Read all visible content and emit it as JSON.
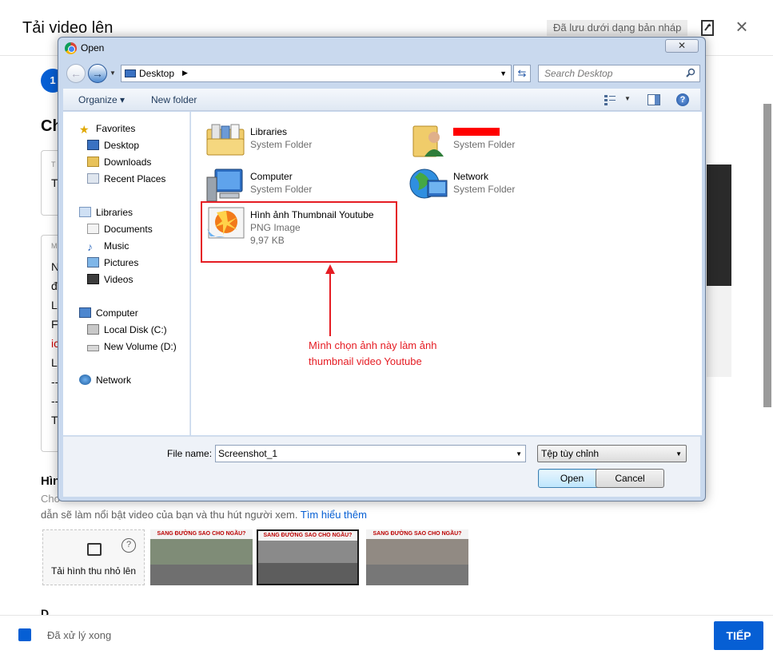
{
  "youtube": {
    "title": "Tải video lên",
    "draft_badge": "Đã lưu dưới dạng bản nháp",
    "step_number": "1",
    "heading_fragment": "Ch",
    "box1": {
      "label_fragment": "T",
      "value_fragment": "T"
    },
    "box2": {
      "label_fragment": "M",
      "lines": [
        "N",
        "đ",
        "L",
        "F",
        "ic",
        "L",
        "--",
        "--",
        "T"
      ]
    },
    "thumbnail_title_fragment": "Hìn",
    "thumbnail_desc_fragment": "Cho",
    "thumbnail_desc": "dẫn sẽ làm nổi bật video của bạn và thu hút người xem.",
    "learn_more": "Tìm hiểu thêm",
    "upload_tile_label": "Tải hình thu nhỏ lên",
    "upload_tile_help": "?",
    "thumb_caption": "SANG ĐƯỜNG SAO CHO NGẦU?",
    "footer_fragment": "D",
    "status_text": "Đã xử lý xong",
    "next_button": "TIẾP"
  },
  "dialog": {
    "title": "Open",
    "close_label": "✕",
    "address": "Desktop",
    "search_placeholder": "Search Desktop",
    "toolbar": {
      "organize": "Organize ▾",
      "new_folder": "New folder"
    },
    "nav": {
      "favorites": "Favorites",
      "desktop": "Desktop",
      "downloads": "Downloads",
      "recent": "Recent Places",
      "libraries": "Libraries",
      "documents": "Documents",
      "music": "Music",
      "pictures": "Pictures",
      "videos": "Videos",
      "computer": "Computer",
      "local_disk": "Local Disk (C:)",
      "new_volume": "New Volume (D:)",
      "network": "Network"
    },
    "files": [
      {
        "name": "Libraries",
        "type": "System Folder"
      },
      {
        "name": "",
        "type": "System Folder"
      },
      {
        "name": "Computer",
        "type": "System Folder"
      },
      {
        "name": "Network",
        "type": "System Folder"
      },
      {
        "name": "Hình ảnh Thumbnail Youtube",
        "type": "PNG Image",
        "size": "9,97 KB"
      }
    ],
    "annotation": "Mình chọn ảnh này làm ảnh thumbnail video Youtube",
    "file_name_label": "File name:",
    "file_name_value": "Screenshot_1",
    "file_type": "Tệp tùy chỉnh",
    "open_button": "Open",
    "cancel_button": "Cancel"
  },
  "colors": {
    "youtube_blue": "#065fd4",
    "annotation_red": "#e51c23"
  }
}
